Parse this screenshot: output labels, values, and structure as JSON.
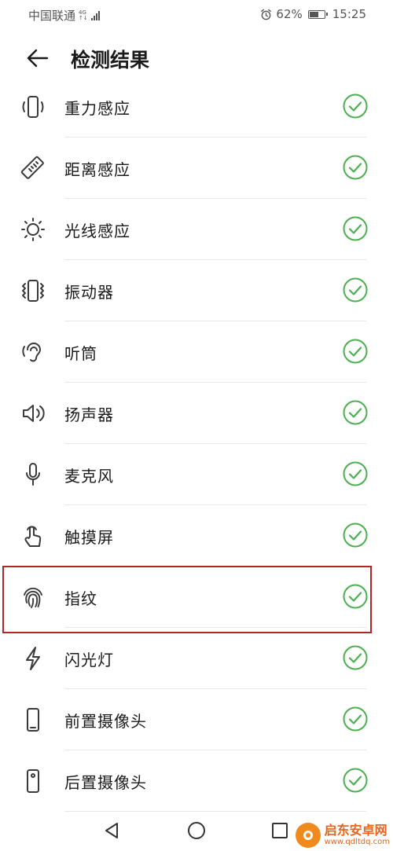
{
  "status_bar": {
    "carrier": "中国联通",
    "network_type": "4G",
    "network_sub": "↑↓",
    "battery_percent": "62%",
    "battery_level": 0.62,
    "time": "15:25",
    "icons": [
      "signal-icon",
      "alarm-icon",
      "battery-icon"
    ]
  },
  "header": {
    "title": "检测结果",
    "back_icon": "back-arrow-icon"
  },
  "items": [
    {
      "label": "重力感应",
      "icon": "gravity-phone-icon",
      "status": "passed"
    },
    {
      "label": "距离感应",
      "icon": "ruler-icon",
      "status": "passed"
    },
    {
      "label": "光线感应",
      "icon": "sun-icon",
      "status": "passed"
    },
    {
      "label": "振动器",
      "icon": "vibration-icon",
      "status": "passed"
    },
    {
      "label": "听筒",
      "icon": "ear-icon",
      "status": "passed"
    },
    {
      "label": "扬声器",
      "icon": "speaker-icon",
      "status": "passed"
    },
    {
      "label": "麦克风",
      "icon": "microphone-icon",
      "status": "passed"
    },
    {
      "label": "触摸屏",
      "icon": "touch-hand-icon",
      "status": "passed"
    },
    {
      "label": "指纹",
      "icon": "fingerprint-icon",
      "status": "passed"
    },
    {
      "label": "闪光灯",
      "icon": "flash-icon",
      "status": "passed"
    },
    {
      "label": "前置摄像头",
      "icon": "phone-front-icon",
      "status": "passed"
    },
    {
      "label": "后置摄像头",
      "icon": "phone-rear-camera-icon",
      "status": "passed"
    }
  ],
  "highlighted_item": "指纹",
  "nav_bar": {
    "icons": [
      "nav-back-icon",
      "nav-home-icon",
      "nav-recents-icon"
    ]
  },
  "watermark": {
    "name": "启东安卓网",
    "url": "www.qdltdq.com"
  },
  "colors": {
    "check_green": "#4caf50",
    "highlight_red": "#b2252b",
    "icon_gray": "#3a3a3a",
    "watermark_orange": "#e8641c"
  }
}
